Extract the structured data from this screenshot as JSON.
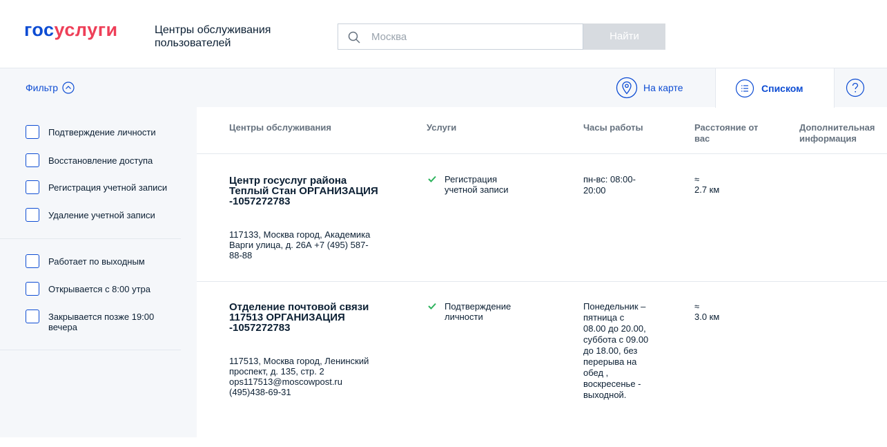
{
  "header": {
    "logo_part1": "гос",
    "logo_part2": "услуги",
    "subtitle": "Центры обслуживания пользователей",
    "search_value": "Москва",
    "find_label": "Найти"
  },
  "toolbar": {
    "filter_label": "Фильтр",
    "map_label": "На карте",
    "list_label": "Списком",
    "help_icon": "question-icon"
  },
  "filters": {
    "group1": [
      "Подтверждение личности",
      "Восстановление доступа",
      "Регистрация учетной записи",
      "Удаление учетной записи"
    ],
    "group2": [
      "Работает по выходным",
      "Открывается с 8:00 утра",
      "Закрывается позже 19:00 вечера"
    ]
  },
  "table": {
    "columns": [
      "Центры обслуживания",
      "Услуги",
      "Часы работы",
      "Расстояние от вас",
      "Дополнительная информация"
    ],
    "rows": [
      {
        "name": "Центр госуслуг района Теплый Стан ОРГАНИЗАЦИЯ -1057272783",
        "address": "117133, Москва город, Академика Варги улица, д. 26А +7 (495) 587-88-88",
        "service": "Регистрация учетной записи",
        "hours": "пн-вс: 08:00-20:00",
        "distance_approx": "≈",
        "distance": "2.7 км"
      },
      {
        "name": "Отделение почтовой связи 117513 ОРГАНИЗАЦИЯ -1057272783",
        "address": "117513, Москва город, Ленинский проспект, д. 135, стр. 2 ops117513@moscowpost.ru (495)438-69-31",
        "service": "Подтверждение личности",
        "hours": "Понедельник – пятница с 08.00 до 20.00, суббота с 09.00 до 18.00, без перерыва на обед , воскресенье - выходной.",
        "distance_approx": "≈",
        "distance": "3.0 км"
      }
    ]
  },
  "colors": {
    "brand_blue": "#0d4cd3",
    "brand_red": "#ee3f58",
    "check_green": "#2db35d",
    "panel_bg": "#f5f7fa"
  }
}
